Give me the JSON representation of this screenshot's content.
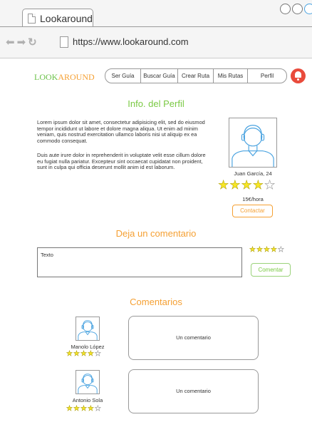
{
  "browser": {
    "tab_title": "Lookaround",
    "url": "https://www.lookaround.com"
  },
  "app": {
    "logo_part1": "LOOK",
    "logo_part2": "AROUND",
    "nav": [
      "Ser Guía",
      "Buscar Guía",
      "Crear Ruta",
      "Mis Rutas",
      "Perfil"
    ]
  },
  "profile": {
    "heading": "Info. del Perfil",
    "paragraph1": "Lorem ipsum dolor sit amet, consectetur adipisicing elit, sed do eiusmod tempor incididunt ut labore et dolore magna aliqua. Ut enim ad minim veniam, quis nostrud exercitation ullamco laboris nisi ut aliquip ex ea commodo consequat.",
    "paragraph2": "Duis aute irure dolor in reprehenderit in voluptate velit esse cillum dolore eu fugiat nulla pariatur. Excepteur sint occaecat cupidatat non proident, sunt in culpa qui officia deserunt mollit anim id est laborum.",
    "name": "Juan García, 24",
    "rating": 4,
    "rating_max": 5,
    "price": "15€/hora",
    "contact_label": "Contactar"
  },
  "comment_form": {
    "heading": "Deja un comentario",
    "textbox_placeholder": "Texto",
    "rating": 4,
    "rating_max": 5,
    "submit_label": "Comentar"
  },
  "comments": {
    "heading": "Comentarios",
    "items": [
      {
        "name": "Manolo López",
        "rating": 4,
        "rating_max": 5,
        "text": "Un comentario"
      },
      {
        "name": "Antonio Sola",
        "rating": 4,
        "rating_max": 5,
        "text": "Un comentario"
      }
    ]
  },
  "colors": {
    "accent_green": "#7ac943",
    "accent_orange": "#f5a033",
    "star_yellow": "#f7e625",
    "bell_red": "#e94b3c",
    "avatar_blue": "#4aa3e0"
  }
}
